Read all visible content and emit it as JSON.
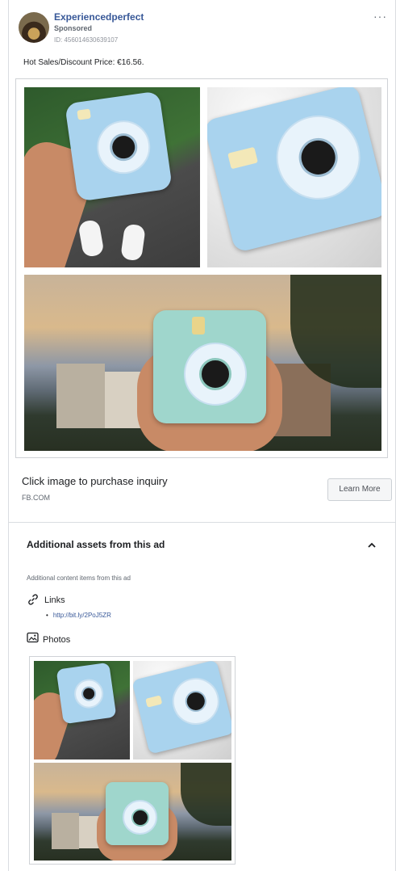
{
  "post": {
    "page_name": "Experiencedperfect",
    "sponsored_label": "Sponsored",
    "ad_id": "ID: 456014630639107",
    "more_label": "···",
    "text": "Hot Sales/Discount Price: €16.56."
  },
  "cta": {
    "headline": "Click image to purchase inquiry",
    "domain": "FB.COM",
    "button_label": "Learn More"
  },
  "assets": {
    "title": "Additional assets from this ad",
    "subtitle": "Additional content items from this ad",
    "links_label": "Links",
    "links": [
      "http://bit.ly/2PoJ5ZR"
    ],
    "photos_label": "Photos"
  },
  "icons": {
    "more": "more-options-icon",
    "collapse": "chevron-up-icon",
    "links": "link-icon",
    "photos": "photo-icon"
  },
  "colors": {
    "link": "#385898",
    "camera": "#a9d3ee",
    "border": "#dadde1"
  }
}
